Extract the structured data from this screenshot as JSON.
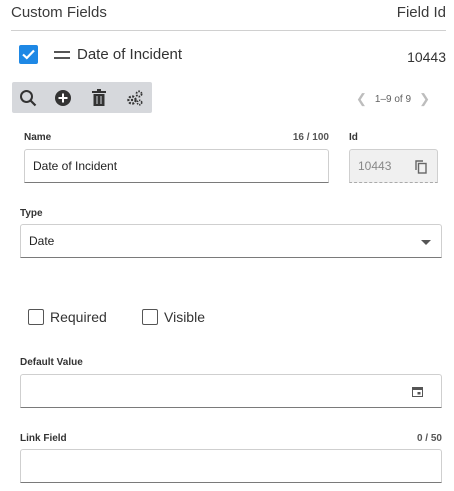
{
  "header": {
    "title": "Custom Fields",
    "id_column": "Field Id"
  },
  "field_row": {
    "label": "Date of Incident",
    "field_id": "10443",
    "checked": true
  },
  "toolbar": {
    "icons": [
      "search-icon",
      "add-circle-icon",
      "trash-icon",
      "cogs-icon"
    ]
  },
  "pager": {
    "text": "1–9 of 9"
  },
  "form": {
    "name": {
      "label": "Name",
      "value": "Date of Incident",
      "counter": "16 / 100"
    },
    "id": {
      "label": "Id",
      "value": "10443"
    },
    "type": {
      "label": "Type",
      "value": "Date"
    },
    "required": {
      "label": "Required",
      "checked": false
    },
    "visible": {
      "label": "Visible",
      "checked": false
    },
    "default_value": {
      "label": "Default Value",
      "value": ""
    },
    "link_field": {
      "label": "Link Field",
      "value": "",
      "counter": "0 / 50"
    }
  },
  "colors": {
    "accent": "#1e88e5",
    "toolbar_bg": "#d6d8dc"
  }
}
